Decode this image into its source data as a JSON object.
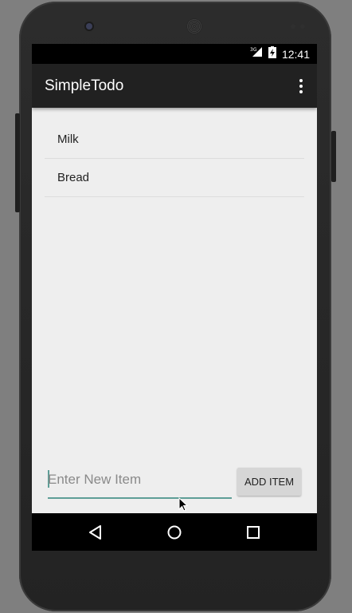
{
  "status_bar": {
    "network": "3G",
    "time": "12:41"
  },
  "app": {
    "title": "SimpleTodo"
  },
  "todo_items": [
    {
      "label": "Milk"
    },
    {
      "label": "Bread"
    }
  ],
  "new_item": {
    "placeholder": "Enter New Item",
    "value": "",
    "button_label": "ADD ITEM"
  },
  "colors": {
    "accent": "#5e9e97",
    "action_bar": "#212121",
    "background": "#eeeeee"
  }
}
